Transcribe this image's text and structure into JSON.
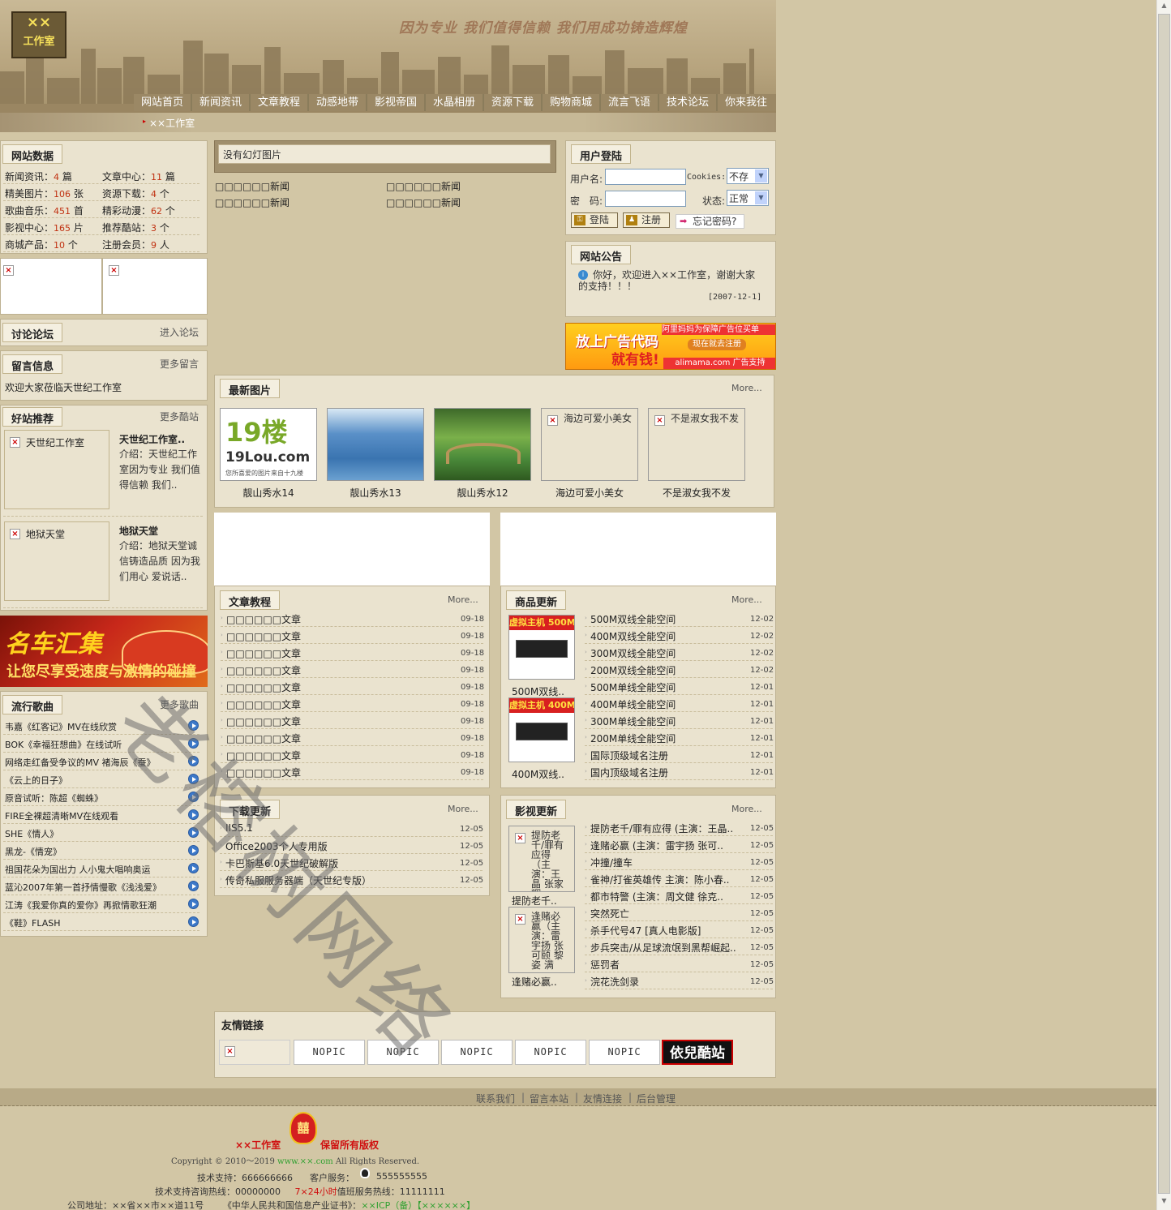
{
  "header": {
    "logo_line1": "××",
    "logo_line2": "工作室",
    "slogan": "因为专业 我们值得信赖 我们用成功铸造辉煌",
    "breadcrumb": "××工作室"
  },
  "nav": [
    "网站首页",
    "新闻资讯",
    "文章教程",
    "动感地带",
    "影视帝国",
    "水晶相册",
    "资源下载",
    "购物商城",
    "流言飞语",
    "技术论坛",
    "你来我往"
  ],
  "site_data": {
    "title": "网站数据",
    "stats": [
      {
        "label": "新闻资讯：",
        "value": "4",
        "unit": "篇"
      },
      {
        "label": "文章中心：",
        "value": "11",
        "unit": "篇"
      },
      {
        "label": "精美图片：",
        "value": "106",
        "unit": "张"
      },
      {
        "label": "资源下载：",
        "value": "4",
        "unit": "个"
      },
      {
        "label": "歌曲音乐：",
        "value": "451",
        "unit": "首"
      },
      {
        "label": "精彩动漫：",
        "value": "62",
        "unit": "个"
      },
      {
        "label": "影视中心：",
        "value": "165",
        "unit": "片"
      },
      {
        "label": "推荐酷站：",
        "value": "3",
        "unit": "个"
      },
      {
        "label": "商城产品：",
        "value": "10",
        "unit": "个"
      },
      {
        "label": "注册会员：",
        "value": "9",
        "unit": "人"
      }
    ]
  },
  "forum": {
    "title": "讨论论坛",
    "more": "进入论坛"
  },
  "guestbook": {
    "title": "留言信息",
    "more": "更多留言",
    "text": "欢迎大家莅临天世纪工作室"
  },
  "recommend": {
    "title": "好站推荐",
    "more": "更多酷站",
    "sites": [
      {
        "name": "天世纪工作室",
        "title": "天世纪工作室..",
        "desc": "介绍：天世纪工作室因为专业 我们值得信赖 我们.."
      },
      {
        "name": "地狱天堂",
        "title": "地狱天堂",
        "desc": "介绍：地狱天堂诚信铸造品质 因为我们用心 爱说话.."
      }
    ]
  },
  "car_banner": {
    "line1": "名车汇集",
    "line2": "让您尽享受速度与激情的碰撞"
  },
  "songs": {
    "title": "流行歌曲",
    "more": "更多歌曲",
    "items": [
      "韦嘉《红客记》MV在线欣赏",
      "BOK《幸福狂想曲》在线试听",
      "网络走红备受争议的MV 褚海辰《蚕》",
      "《云上的日子》",
      "原音试听：陈超《蜘蛛》",
      "FIRE全裸超清晰MV在线观看",
      "SHE《情人》",
      "黑龙-《情宠》",
      "祖国花朵为国出力 人小鬼大唱响奥运",
      "蓝沁2007年第一首抒情慢歌《浅浅爱》",
      "江涛《我爱你真的爱你》再掀情歌狂潮",
      "《鞋》FLASH"
    ]
  },
  "slideshow": {
    "text": "没有幻灯图片"
  },
  "news": [
    "□□□□□□新闻",
    "□□□□□□新闻",
    "□□□□□□新闻",
    "□□□□□□新闻"
  ],
  "login": {
    "title": "用户登陆",
    "user_label": "用户名:",
    "pass_label": "密　码:",
    "cookies_label": "Cookies:",
    "cookies_value": "不存",
    "state_label": "状态:",
    "state_value": "正常",
    "login_btn": "登陆",
    "register_btn": "注册",
    "forgot": "忘记密码?"
  },
  "notice": {
    "title": "网站公告",
    "text": "你好，欢迎进入××工作室，谢谢大家的支持！！！",
    "date": "[2007-12-1]"
  },
  "ad": {
    "line1": "放上广告代码",
    "line2": "就有钱!",
    "top": "阿里妈妈为保障广告位买单",
    "register": "现在就去注册",
    "site": "alimama.com 广告支持"
  },
  "photos": {
    "title": "最新图片",
    "more": "More...",
    "items": [
      {
        "caption": "靓山秀水14",
        "badge": "19楼",
        "sub": "19Lou.com",
        "tag": "您所喜爱的图片来自十九楼"
      },
      {
        "caption": "靓山秀水13"
      },
      {
        "caption": "靓山秀水12"
      },
      {
        "caption": "海边可爱小美女",
        "alt": "海边可爱小美女"
      },
      {
        "caption": "不是淑女我不发",
        "alt": "不是淑女我不发"
      }
    ]
  },
  "articles": {
    "title": "文章教程",
    "more": "More...",
    "items": [
      {
        "t": "□□□□□□文章",
        "d": "09-18"
      },
      {
        "t": "□□□□□□文章",
        "d": "09-18"
      },
      {
        "t": "□□□□□□文章",
        "d": "09-18"
      },
      {
        "t": "□□□□□□文章",
        "d": "09-18"
      },
      {
        "t": "□□□□□□文章",
        "d": "09-18"
      },
      {
        "t": "□□□□□□文章",
        "d": "09-18"
      },
      {
        "t": "□□□□□□文章",
        "d": "09-18"
      },
      {
        "t": "□□□□□□文章",
        "d": "09-18"
      },
      {
        "t": "□□□□□□文章",
        "d": "09-18"
      },
      {
        "t": "□□□□□□文章",
        "d": "09-18"
      }
    ]
  },
  "products": {
    "title": "商品更新",
    "more": "More...",
    "thumbs": [
      {
        "caption": "500M双线..",
        "banner": "虚拟主机 500M"
      },
      {
        "caption": "400M双线..",
        "banner": "虚拟主机 400M"
      }
    ],
    "items": [
      {
        "t": "500M双线全能空间",
        "d": "12-02"
      },
      {
        "t": "400M双线全能空间",
        "d": "12-02"
      },
      {
        "t": "300M双线全能空间",
        "d": "12-02"
      },
      {
        "t": "200M双线全能空间",
        "d": "12-02"
      },
      {
        "t": "500M单线全能空间",
        "d": "12-01"
      },
      {
        "t": "400M单线全能空间",
        "d": "12-01"
      },
      {
        "t": "300M单线全能空间",
        "d": "12-01"
      },
      {
        "t": "200M单线全能空间",
        "d": "12-01"
      },
      {
        "t": "国际顶级域名注册",
        "d": "12-01"
      },
      {
        "t": "国内顶级域名注册",
        "d": "12-01"
      }
    ]
  },
  "downloads": {
    "title": "下载更新",
    "more": "More...",
    "items": [
      {
        "t": "IIS5.1",
        "d": "12-05"
      },
      {
        "t": "Office2003个人专用版",
        "d": "12-05"
      },
      {
        "t": "卡巴斯基6.0天世纪破解版",
        "d": "12-05"
      },
      {
        "t": "传奇私服服务器端（天世纪专版）",
        "d": "12-05"
      }
    ]
  },
  "movies": {
    "title": "影视更新",
    "more": "More...",
    "thumbs": [
      {
        "alt": "提防老千/罪有应得（主演：王晶 张家辉",
        "caption": "提防老千.."
      },
      {
        "alt": "逢赌必赢（主演：雷宇扬 张可颐 黎姿 满",
        "caption": "逢赌必赢.."
      }
    ],
    "items": [
      {
        "t": "提防老千/罪有应得 (主演：王晶..",
        "d": "12-05"
      },
      {
        "t": "逢赌必赢 (主演：雷宇扬 张可..",
        "d": "12-05"
      },
      {
        "t": "冲撞/撞车",
        "d": "12-05"
      },
      {
        "t": "雀神/打雀英雄传 主演：陈小春..",
        "d": "12-05"
      },
      {
        "t": "都市特警 (主演：周文健 徐克..",
        "d": "12-05"
      },
      {
        "t": "突然死亡",
        "d": "12-05"
      },
      {
        "t": "杀手代号47 [真人电影版]",
        "d": "12-05"
      },
      {
        "t": "步兵突击/从足球流氓到黑帮崛起..",
        "d": "12-05"
      },
      {
        "t": "惩罚者",
        "d": "12-05"
      },
      {
        "t": "浣花洗剑录",
        "d": "12-05"
      }
    ]
  },
  "links": {
    "title": "友情链接",
    "nopic": [
      "NOPIC",
      "NOPIC",
      "NOPIC",
      "NOPIC",
      "NOPIC"
    ],
    "last": "依兒酷站"
  },
  "footer": {
    "links": [
      "联系我们",
      "留言本站",
      "友情连接",
      "后台管理"
    ],
    "brand": "××工作室",
    "rights": "保留所有版权",
    "copyright": "Copyright © 2010～2019",
    "url": "www.××.com",
    "reserved": "All Rights Reserved.",
    "tech": "技术支持：666666666",
    "service": "客户服务：",
    "service_num": "555555555",
    "hotline": "技术支持咨询热线：00000000",
    "hours": "7×24小时",
    "duty": "值班服务热线：11111111",
    "address": "公司地址：××省××市××道11号",
    "license": "《中华人民共和国信息产业证书》：",
    "icp": "××ICP（备）【××××××】"
  },
  "watermark": "老榕树网络"
}
